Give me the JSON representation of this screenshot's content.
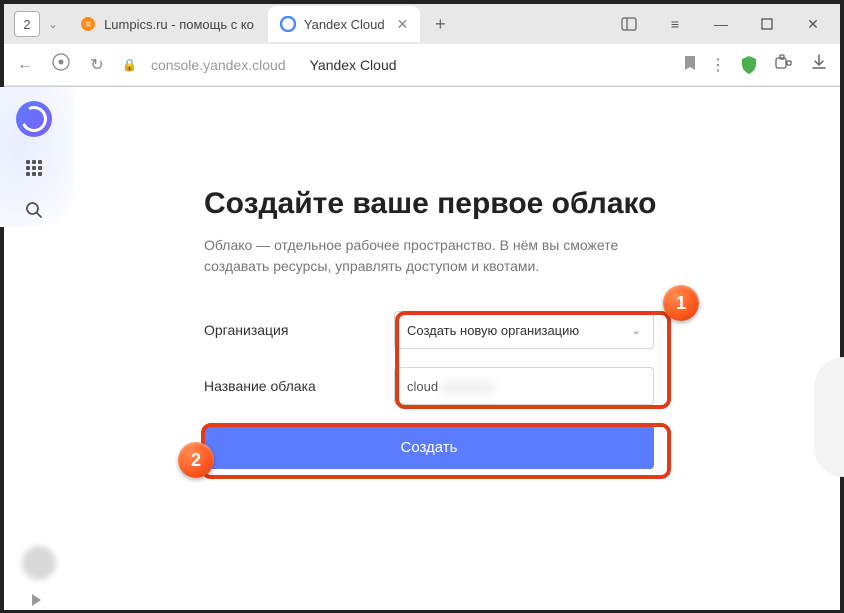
{
  "browser": {
    "tabCount": "2",
    "tabs": [
      {
        "title": "Lumpics.ru - помощь с ко"
      },
      {
        "title": "Yandex Cloud"
      }
    ],
    "url": "console.yandex.cloud",
    "pageTitle": "Yandex Cloud"
  },
  "page": {
    "heading": "Создайте ваше первое облако",
    "subtext": "Облако — отдельное рабочее пространство. В нём вы сможете создавать ресурсы, управлять доступом и квотами.",
    "form": {
      "orgLabel": "Организация",
      "orgSelectValue": "Создать новую организацию",
      "nameLabel": "Название облака",
      "nameValue": "cloud",
      "submit": "Создать"
    }
  },
  "annotations": {
    "badge1": "1",
    "badge2": "2"
  }
}
